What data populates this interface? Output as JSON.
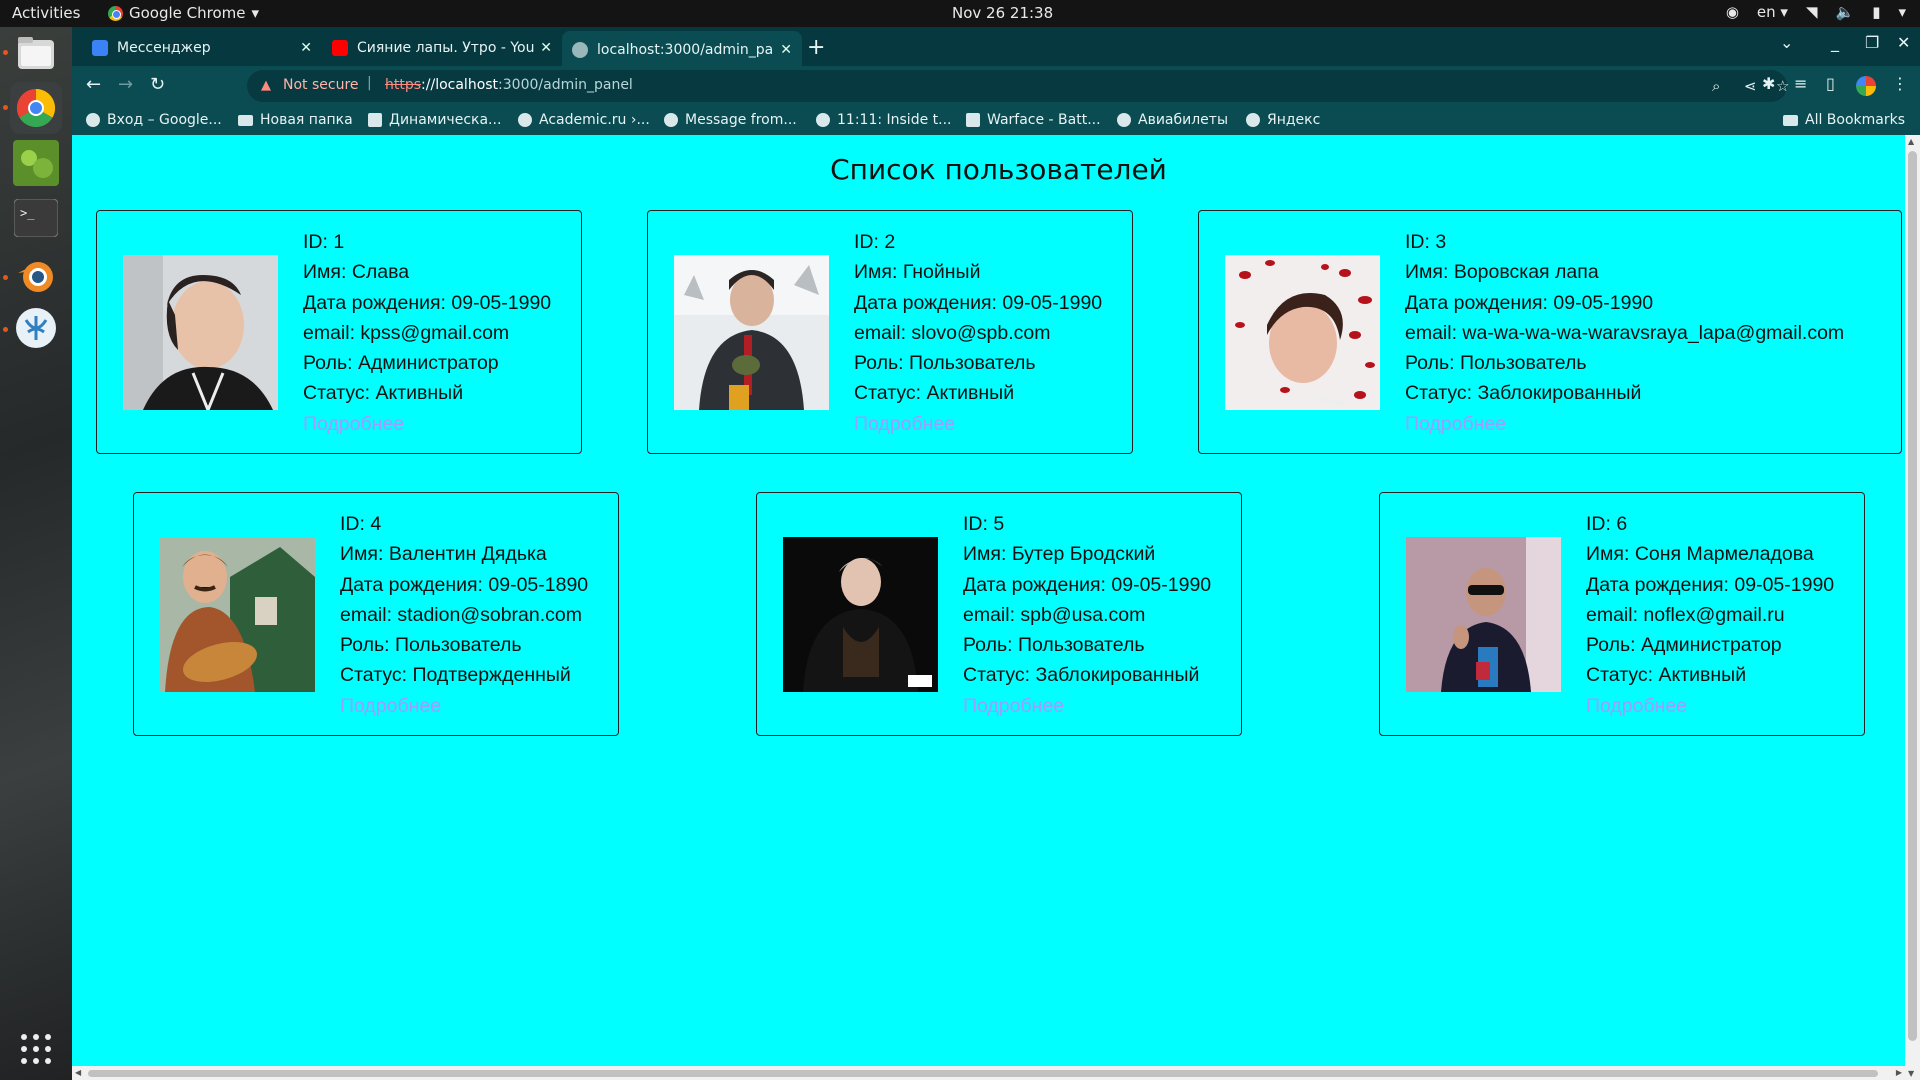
{
  "topbar": {
    "activities": "Activities",
    "app_name": "Google Chrome",
    "clock": "Nov 26  21:38",
    "lang": "en"
  },
  "tabs": [
    {
      "title": "Мессенджер",
      "favicon_color": "#3b82f6"
    },
    {
      "title": "Сияние лапы. Утро - You",
      "favicon_color": "#ff0000"
    },
    {
      "title": "localhost:3000/admin_pa",
      "favicon_color": "#9ab7ba"
    }
  ],
  "toolbar": {
    "not_secure": "Not secure",
    "separator": "|",
    "url_scheme": "https",
    "url_host": "://localhost",
    "url_path": ":3000/admin_panel"
  },
  "bookmarks": [
    {
      "label": "Вход – Google..."
    },
    {
      "label": "Новая папка"
    },
    {
      "label": "Динамическа..."
    },
    {
      "label": "Academic.ru ›..."
    },
    {
      "label": "Message from..."
    },
    {
      "label": "11:11: Inside t..."
    },
    {
      "label": "Warface - Batt..."
    },
    {
      "label": "Авиабилеты"
    },
    {
      "label": "Яндекс"
    }
  ],
  "all_bookmarks": "All Bookmarks",
  "page": {
    "title": "Список пользователей",
    "more_label": "Подробнее",
    "users": [
      {
        "id": "ID: 1",
        "name": "Имя: Слава",
        "dob": "Дата рождения: 09-05-1990",
        "email": "email: kpss@gmail.com",
        "role": "Роль: Администратор",
        "status": "Статус: Активный"
      },
      {
        "id": "ID: 2",
        "name": "Имя: Гнойный",
        "dob": "Дата рождения: 09-05-1990",
        "email": "email: slovo@spb.com",
        "role": "Роль: Пользователь",
        "status": "Статус: Активный"
      },
      {
        "id": "ID: 3",
        "name": "Имя: Воровская лапа",
        "dob": "Дата рождения: 09-05-1990",
        "email": "email: wa-wa-wa-wa-waravsraya_lapa@gmail.com",
        "role": "Роль: Пользователь",
        "status": "Статус: Заблокированный"
      },
      {
        "id": "ID: 4",
        "name": "Имя: Валентин Дядька",
        "dob": "Дата рождения: 09-05-1890",
        "email": "email: stadion@sobran.com",
        "role": "Роль: Пользователь",
        "status": "Статус: Подтвержденный"
      },
      {
        "id": "ID: 5",
        "name": "Имя: Бутер Бродский",
        "dob": "Дата рождения: 09-05-1990",
        "email": "email: spb@usa.com",
        "role": "Роль: Пользователь",
        "status": "Статус: Заблокированный"
      },
      {
        "id": "ID: 6",
        "name": "Имя: Соня Мармеладова",
        "dob": "Дата рождения: 09-05-1990",
        "email": "email: noflex@gmail.ru",
        "role": "Роль: Администратор",
        "status": "Статус: Активный"
      }
    ]
  },
  "colors": {
    "page_background": "#00ffff",
    "link": "#9f9bff",
    "chrome_frame": "#06393f",
    "chrome_toolbar": "#0a4c52"
  }
}
